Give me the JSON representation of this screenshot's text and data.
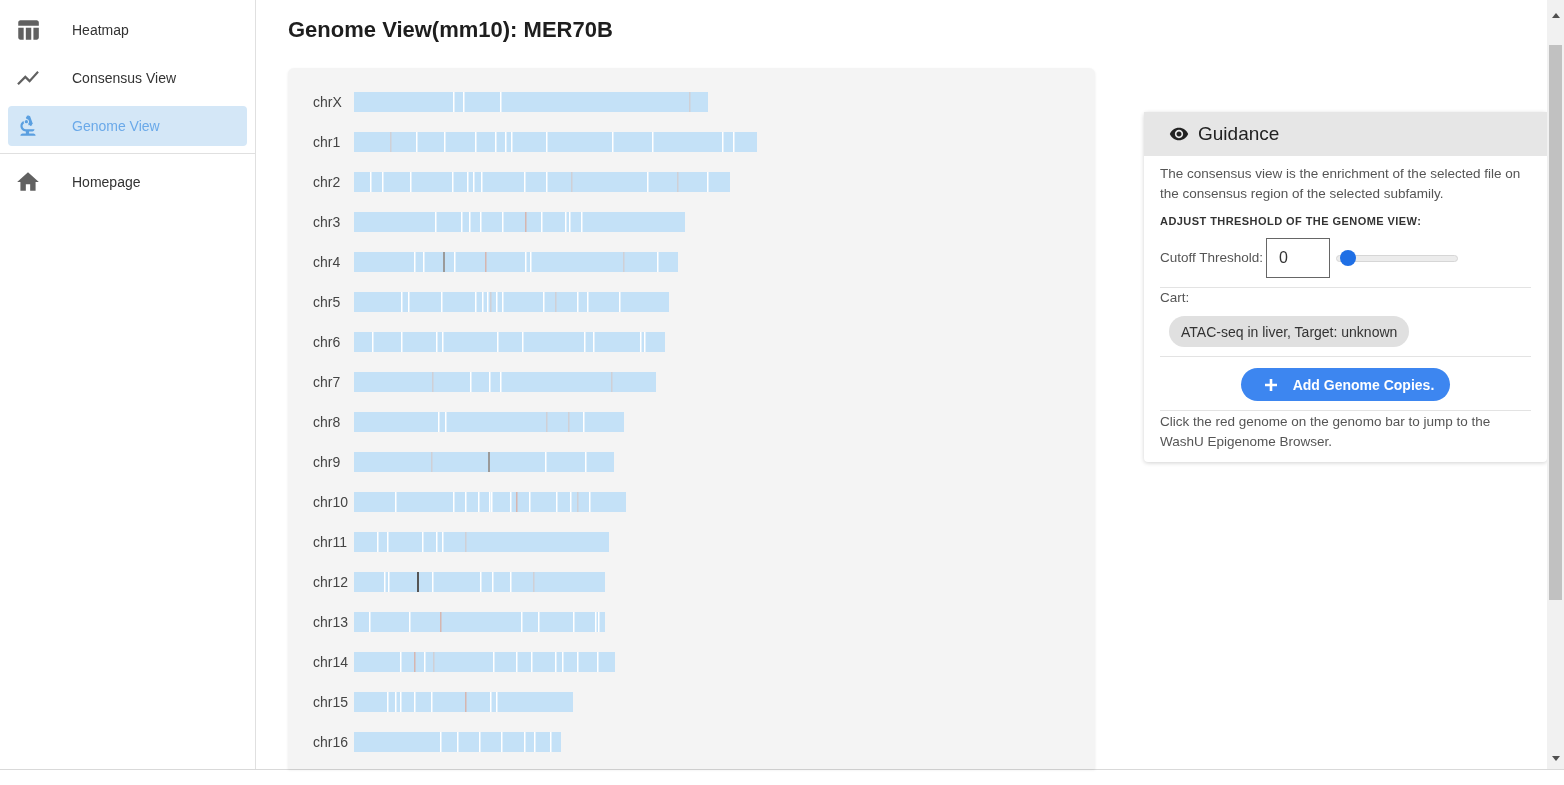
{
  "sidebar": {
    "sections": [
      {
        "items": [
          {
            "label": "Heatmap",
            "selected": false
          },
          {
            "label": "Consensus View",
            "selected": false
          },
          {
            "label": "Genome View",
            "selected": true
          }
        ]
      },
      {
        "items": [
          {
            "label": "Homepage",
            "selected": false
          }
        ]
      }
    ]
  },
  "page_title": "Genome View(mm10): MER70B",
  "genome_view": {
    "chromosomes": [
      "chrX",
      "chr1",
      "chr2",
      "chr3",
      "chr4",
      "chr5",
      "chr6",
      "chr7",
      "chr8",
      "chr9",
      "chr10",
      "chr11",
      "chr12",
      "chr13",
      "chr14",
      "chr15",
      "chr16"
    ]
  },
  "guidance": {
    "title": "Guidance",
    "description": "The consensus view is the enrichment of the selected file on the consensus region of the selected subfamily.",
    "threshold_heading": "ADJUST THRESHOLD OF THE GENOME VIEW:",
    "cutoff": {
      "label": "Cutoff Threshold:",
      "value": "0",
      "level": 0
    },
    "cart": {
      "label": "Cart:",
      "items": [
        "ATAC-seq in liver, Target: unknown"
      ]
    },
    "add_button": {
      "label": "Add Genome Copies."
    },
    "note": "Click the red genome on the genomo bar to jump to the WashU Epigenome Browser."
  }
}
